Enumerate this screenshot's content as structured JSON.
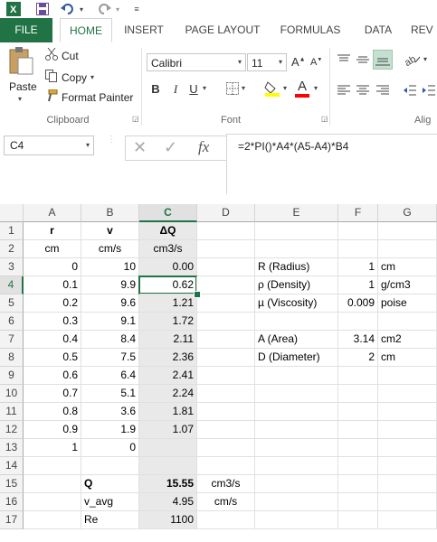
{
  "colors": {
    "accent": "#217346",
    "file_tab": "#217346",
    "fill_yellow": "#ffff00",
    "font_red": "#ff0000"
  },
  "tabs": [
    {
      "label": "FILE"
    },
    {
      "label": "HOME"
    },
    {
      "label": "INSERT"
    },
    {
      "label": "PAGE LAYOUT"
    },
    {
      "label": "FORMULAS"
    },
    {
      "label": "DATA"
    },
    {
      "label": "REV"
    }
  ],
  "clipboard": {
    "paste": "Paste",
    "cut": "Cut",
    "copy": "Copy",
    "format_painter": "Format Painter",
    "group": "Clipboard"
  },
  "font": {
    "name": "Calibri",
    "size": "11",
    "group": "Font",
    "bold": "B",
    "italic": "I",
    "underline": "U"
  },
  "alignment": {
    "group": "Alig"
  },
  "name_box": "C4",
  "formula": "=2*PI()*A4*(A5-A4)*B4",
  "columns": [
    "A",
    "B",
    "C",
    "D",
    "E",
    "F",
    "G"
  ],
  "rows": [
    "1",
    "2",
    "3",
    "4",
    "5",
    "6",
    "7",
    "8",
    "9",
    "10",
    "11",
    "12",
    "13",
    "14",
    "15",
    "16",
    "17"
  ],
  "cells": {
    "A1": "r",
    "B1": "v",
    "C1": "ΔQ",
    "A2": "cm",
    "B2": "cm/s",
    "C2": "cm3/s",
    "A3": "0",
    "B3": "10",
    "C3": "0.00",
    "E3": "R (Radius)",
    "F3": "1",
    "G3": "cm",
    "A4": "0.1",
    "B4": "9.9",
    "C4": "0.62",
    "E4": "ρ (Density)",
    "F4": "1",
    "G4": "g/cm3",
    "A5": "0.2",
    "B5": "9.6",
    "C5": "1.21",
    "E5": "µ (Viscosity)",
    "F5": "0.009",
    "G5": "poise",
    "A6": "0.3",
    "B6": "9.1",
    "C6": "1.72",
    "A7": "0.4",
    "B7": "8.4",
    "C7": "2.11",
    "E7": "A (Area)",
    "F7": "3.14",
    "G7": "cm2",
    "A8": "0.5",
    "B8": "7.5",
    "C8": "2.36",
    "E8": "D (Diameter)",
    "F8": "2",
    "G8": "cm",
    "A9": "0.6",
    "B9": "6.4",
    "C9": "2.41",
    "A10": "0.7",
    "B10": "5.1",
    "C10": "2.24",
    "A11": "0.8",
    "B11": "3.6",
    "C11": "1.81",
    "A12": "0.9",
    "B12": "1.9",
    "C12": "1.07",
    "A13": "1",
    "B13": "0",
    "B15": "Q",
    "C15": "15.55",
    "D15": "cm3/s",
    "B16": "v_avg",
    "C16": "4.95",
    "D16": "cm/s",
    "B17": "Re",
    "C17": "1100"
  }
}
